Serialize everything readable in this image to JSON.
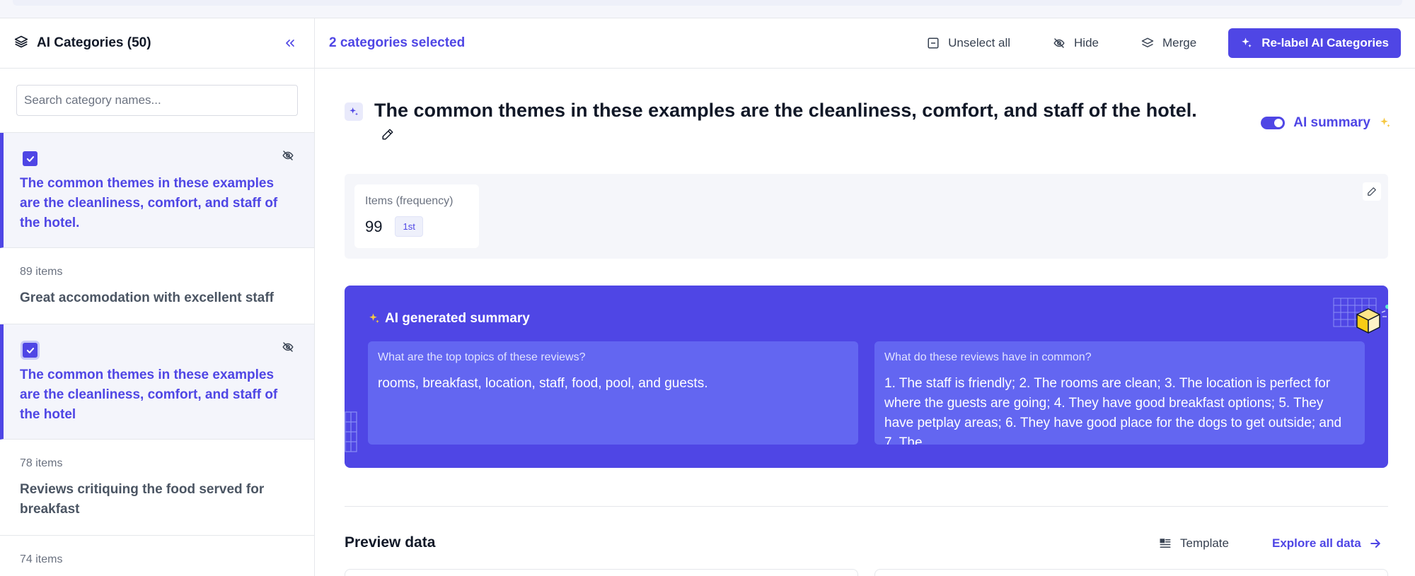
{
  "sidebar": {
    "title": "AI Categories (50)",
    "search_placeholder": "Search category names...",
    "items": [
      {
        "count": "",
        "label": "The common themes in these examples are the cleanliness, comfort, and staff of the hotel.",
        "selected": true
      },
      {
        "count": "89 items",
        "label": "Great accomodation with excellent staff",
        "selected": false
      },
      {
        "count": "",
        "label": "The common themes in these examples are the cleanliness, comfort, and staff of the hotel",
        "selected": true
      },
      {
        "count": "78 items",
        "label": "Reviews critiquing the food served for breakfast",
        "selected": false
      },
      {
        "count": "74 items",
        "label": "",
        "selected": false
      }
    ]
  },
  "toolbar": {
    "selected_text": "2 categories selected",
    "unselect_label": "Unselect all",
    "hide_label": "Hide",
    "merge_label": "Merge",
    "relabel_label": "Re-label AI Categories"
  },
  "detail": {
    "title": "The common themes in these examples are the cleanliness, comfort, and staff of the hotel.",
    "ai_summary_toggle_label": "AI summary",
    "ai_summary_enabled": true,
    "stat": {
      "label": "Items (frequency)",
      "value": "99",
      "rank": "1st"
    }
  },
  "summary": {
    "heading": "AI generated summary",
    "cards": [
      {
        "question": "What are the top topics of these reviews?",
        "answer": "rooms, breakfast, location, staff, food, pool, and guests."
      },
      {
        "question": "What do these reviews have in common?",
        "answer": "1. The staff is friendly; 2. The rooms are clean; 3. The location is perfect for where the guests are going; 4. They have good breakfast options; 5. They have petplay areas; 6. They have good place for the dogs to get outside; and 7. The"
      }
    ]
  },
  "preview": {
    "title": "Preview data",
    "template_label": "Template",
    "explore_label": "Explore all data"
  },
  "colors": {
    "accent": "#4f46e5",
    "accent_light": "#6366f1",
    "sparkle": "#f5c842"
  }
}
